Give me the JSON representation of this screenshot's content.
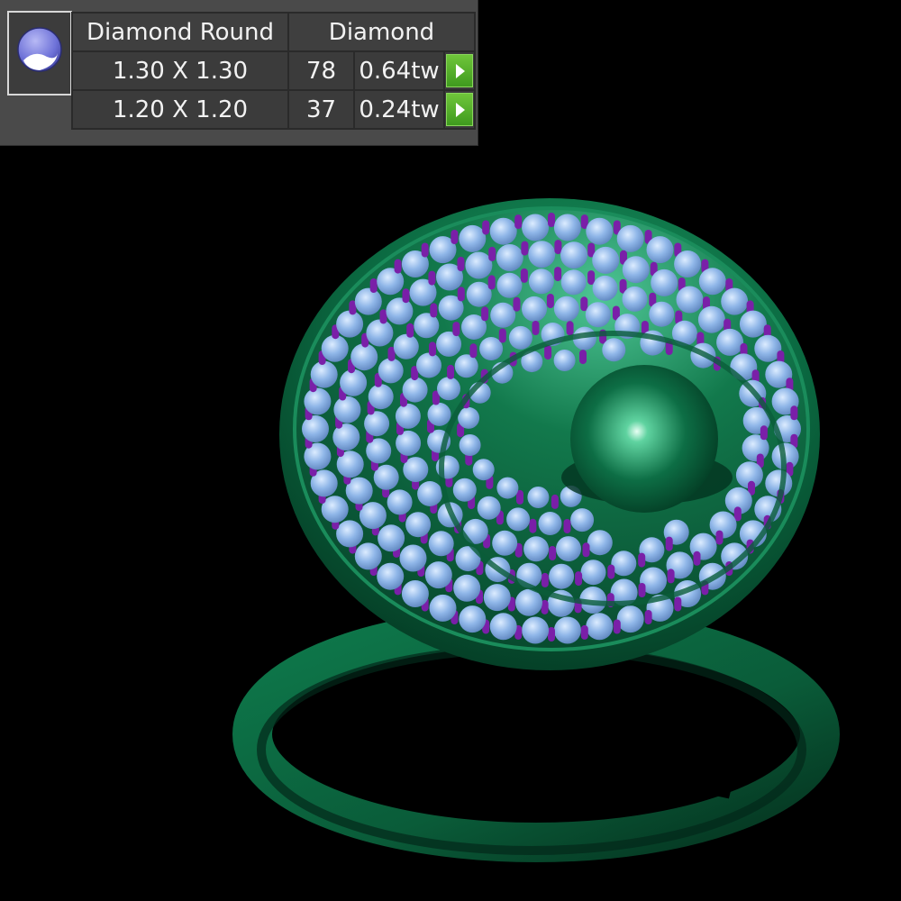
{
  "stone_panel": {
    "shape_icon": "round-diamond-icon",
    "shape_header": "Diamond Round",
    "material_header": "Diamond",
    "rows": [
      {
        "size": "1.30 X 1.30",
        "count": "78",
        "weight": "0.64tw"
      },
      {
        "size": "1.20 X 1.20",
        "count": "37",
        "weight": "0.24tw"
      }
    ]
  },
  "colors": {
    "metal": "#0d6e45",
    "stone": "#8fb6e8",
    "prong": "#7a1fa8",
    "go_button": "#4fae26"
  }
}
